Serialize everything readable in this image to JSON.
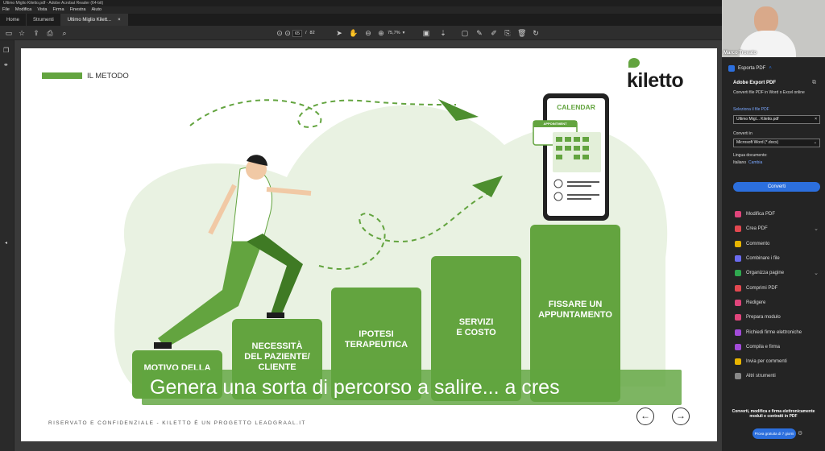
{
  "window": {
    "title": "Ultimo Miglio Kiletto.pdf - Adobe Acrobat Reader (64-bit)"
  },
  "menu": [
    "File",
    "Modifica",
    "Vista",
    "Firma",
    "Finestra",
    "Aiuto"
  ],
  "tabs": [
    {
      "label": "Home"
    },
    {
      "label": "Strumenti"
    },
    {
      "label": "Ultimo Miglio Kilett...",
      "close": "×"
    }
  ],
  "toolbar": {
    "page_current": "65",
    "page_sep": "/",
    "page_total": "82",
    "zoom": "75,7%"
  },
  "slide": {
    "section_label": "IL METODO",
    "logo": "kiletto",
    "calendar_title": "CALENDAR",
    "appointment_badge": "APPOINTMENT",
    "steps": [
      "MOTIVO DELLA",
      "NECESSITÀ\nDEL PAZIENTE/\nCLIENTE",
      "IPOTESI\nTERAPEUTICA",
      "SERVIZI\nE COSTO",
      "FISSARE UN\nAPPUNTAMENTO"
    ],
    "footer": "RISERVATO E CONFIDENZIALE - KILETTO È UN PROGETTO LEADGRAAL.IT",
    "nav_prev": "←",
    "nav_next": "→"
  },
  "subtitle": "Genera una sorta di percorso a salire... a cres",
  "webcam": {
    "name": "Marco Trovato"
  },
  "export": {
    "header": "Esporta PDF",
    "title": "Adobe Export PDF",
    "desc": "Converti file PDF in Word o Excel online",
    "select_label": "Seleziona il file PDF",
    "file_value": "Ultimo Migl... Kiletto.pdf",
    "convert_label": "Converti in",
    "format_value": "Microsoft Word (*.docx)",
    "lang_label": "Lingua documento:",
    "lang_value": "Italiano",
    "lang_change": "Cambia",
    "convert_button": "Converti"
  },
  "tools": [
    {
      "label": "Modifica PDF",
      "color": "#e0457b"
    },
    {
      "label": "Crea PDF",
      "color": "#e34850",
      "chevron": "⌄"
    },
    {
      "label": "Commento",
      "color": "#e8b400"
    },
    {
      "label": "Combinare i file",
      "color": "#6b6bf0"
    },
    {
      "label": "Organizza pagine",
      "color": "#2fa84f",
      "chevron": "⌄"
    },
    {
      "label": "Comprimi PDF",
      "color": "#e34850"
    },
    {
      "label": "Redigere",
      "color": "#e0457b"
    },
    {
      "label": "Prepara modulo",
      "color": "#e0457b"
    },
    {
      "label": "Richiedi firme elettroniche",
      "color": "#a24bd8"
    },
    {
      "label": "Compila e firma",
      "color": "#a24bd8"
    },
    {
      "label": "Invia per commenti",
      "color": "#e8b400"
    },
    {
      "label": "Altri strumenti",
      "color": "#888888"
    }
  ],
  "promo": {
    "text": "Converti, modifica e firma elettronicamente moduli e contratti in PDF",
    "button": "Prova gratuita di 7 giorni"
  },
  "colors": {
    "accent_green": "#63a43f",
    "light_green": "#e8f2e1",
    "acrobat_blue": "#2c6fdd"
  }
}
